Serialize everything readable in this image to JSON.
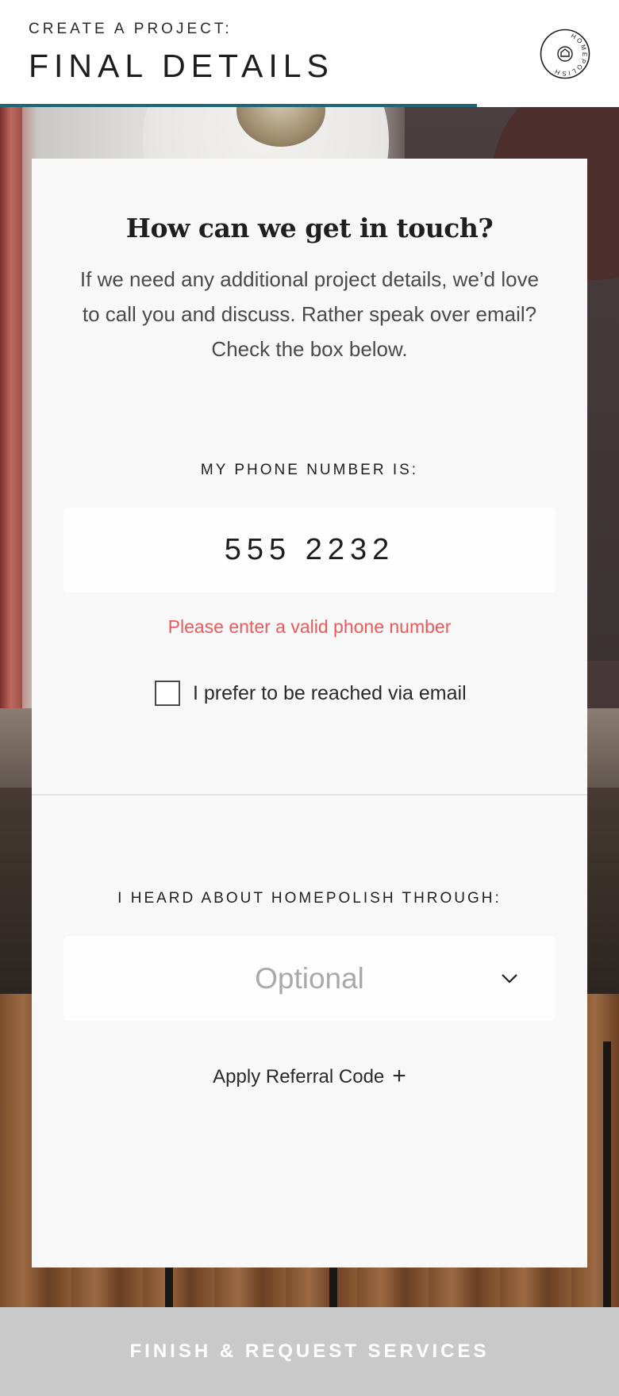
{
  "header": {
    "eyebrow": "CREATE A PROJECT:",
    "title": "FINAL DETAILS",
    "progress_fraction": 0.77,
    "progress_color": "#1f6676",
    "logo_text": "HOMEPOLISH"
  },
  "card": {
    "heading": "How can we get in touch?",
    "description": "If we need any additional project details, we’d love to call you and discuss. Rather speak over email? Check the box below.",
    "phone": {
      "label": "MY PHONE NUMBER IS:",
      "value": "555 2232",
      "error": "Please enter a valid phone number",
      "error_color": "#ea5a5a"
    },
    "email_pref": {
      "label": "I prefer to be reached via email",
      "checked": false
    },
    "source": {
      "label": "I HEARD ABOUT HOMEPOLISH THROUGH:",
      "placeholder": "Optional",
      "icon": "chevron-down-icon"
    },
    "referral": {
      "label": "Apply Referral Code",
      "icon": "plus-icon",
      "icon_glyph": "+"
    }
  },
  "footer": {
    "cta": "FINISH & REQUEST SERVICES"
  }
}
